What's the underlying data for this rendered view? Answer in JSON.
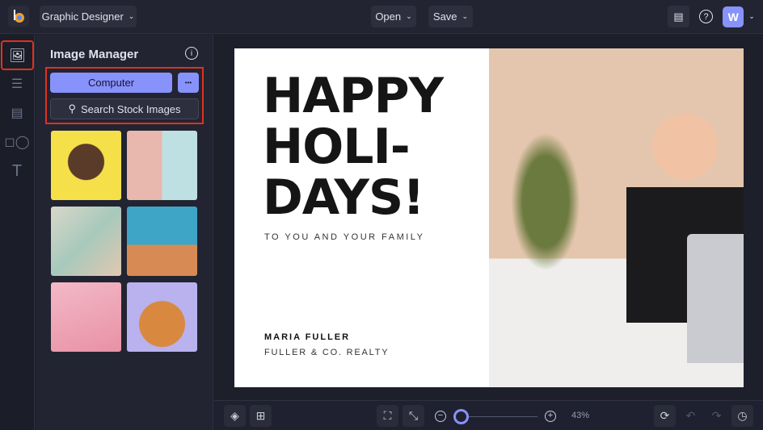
{
  "header": {
    "workspace": "Graphic Designer",
    "open": "Open",
    "save": "Save",
    "avatar": "W"
  },
  "panel": {
    "title": "Image Manager",
    "computer": "Computer",
    "more": "•••",
    "search": "Search Stock Images"
  },
  "card": {
    "line1": "HAPPY",
    "line2": "HOLI-",
    "line3": "DAYS!",
    "subtitle": "TO YOU AND YOUR FAMILY",
    "name": "MARIA FULLER",
    "company": "FULLER & CO. REALTY"
  },
  "footer": {
    "zoom_label": "43%",
    "zoom_value": 43
  },
  "colors": {
    "accent": "#8892fb",
    "highlight": "#e0321c"
  }
}
